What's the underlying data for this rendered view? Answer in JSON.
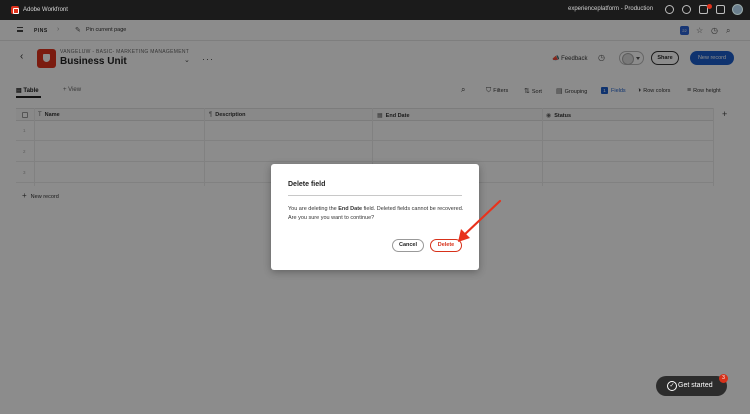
{
  "topbar": {
    "app_name": "Adobe Workfront",
    "environment": "experienceplatform - Production"
  },
  "pinsbar": {
    "pins_label": "PINS",
    "pin_page_label": "Pin current page",
    "calendar_badge": "22"
  },
  "header": {
    "breadcrumb": "VANGELUW - BASIC- MARKETING MANAGEMENT",
    "title": "Business Unit",
    "feedback_label": "Feedback",
    "share_label": "Share",
    "new_record_label": "New record"
  },
  "tabs": {
    "table_label": "Table",
    "add_view_label": "View"
  },
  "toolbar": {
    "filters_label": "Filters",
    "sort_label": "Sort",
    "grouping_label": "Grouping",
    "fields_count": "1",
    "fields_label": "Fields",
    "row_colors_label": "Row colors",
    "row_height_label": "Row height"
  },
  "grid": {
    "columns": [
      {
        "label": "Name",
        "icon": "text-icon"
      },
      {
        "label": "Description",
        "icon": "paragraph-icon"
      },
      {
        "label": "End Date",
        "icon": "calendar-icon"
      },
      {
        "label": "Status",
        "icon": "status-icon"
      }
    ],
    "row_numbers": [
      "1",
      "2",
      "3"
    ],
    "new_record_label": "New record"
  },
  "modal": {
    "title": "Delete field",
    "body_prefix": "You are deleting the ",
    "body_field": "End Date",
    "body_suffix": " field. Deleted fields cannot be recovered. Are you sure you want to continue?",
    "cancel_label": "Cancel",
    "delete_label": "Delete"
  },
  "get_started": {
    "label": "Get started",
    "badge_count": "3"
  },
  "colors": {
    "accent_blue": "#1c5ecb",
    "brand_red": "#e0321c",
    "annotation_arrow": "#e8321c"
  }
}
